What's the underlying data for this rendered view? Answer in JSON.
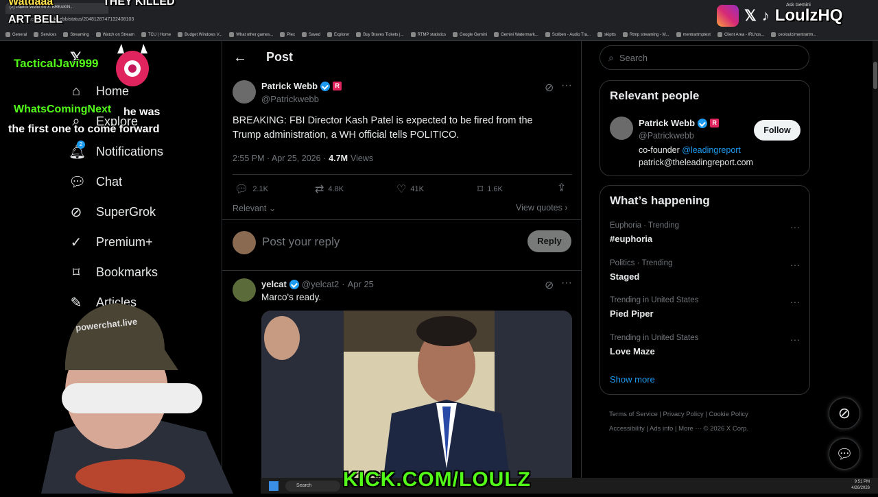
{
  "browser": {
    "tab_title": "(2) Patrick Webb on X: BREAKIN...",
    "url": "x.com/Patrickwebb/status/2048128747132408103",
    "bookmarks": [
      "General",
      "Services",
      "Streaming",
      "Watch on Stream",
      "TCU | Home",
      "Budget Windows V...",
      "What other games...",
      "Plex",
      "Saved",
      "Explorer",
      "Buy Braves Tickets |...",
      "RTMP statistics",
      "Google Gemini",
      "Gemini Watermark...",
      "Scriben - Audio Tra...",
      "skiptts",
      "Rtmp streaming - M...",
      "mentrartmptest",
      "Client Area - lRLhos...",
      "ceoloulz/mentrartm..."
    ],
    "ask_gemini": "Ask Gemini"
  },
  "nav": {
    "items": [
      {
        "label": "Home"
      },
      {
        "label": "Explore"
      },
      {
        "label": "Notifications",
        "badge": "2"
      },
      {
        "label": "Chat"
      },
      {
        "label": "SuperGrok"
      },
      {
        "label": "Premium+"
      },
      {
        "label": "Bookmarks"
      },
      {
        "label": "Articles"
      }
    ]
  },
  "post_header": {
    "title": "Post"
  },
  "post": {
    "author_name": "Patrick Webb",
    "author_handle": "@Patrickwebb",
    "text": "BREAKING: FBI Director Kash Patel is expected to be fired from the Trump administration, a WH official tells POLITICO.",
    "time": "2:55 PM · Apr 25, 2026 ·",
    "views_count": "4.7M",
    "views_label": "Views",
    "replies": "2.1K",
    "reposts": "4.8K",
    "likes": "41K",
    "bookmarks": "1.6K",
    "relevant_label": "Relevant",
    "view_quotes": "View quotes"
  },
  "reply_box": {
    "placeholder": "Post your reply",
    "button": "Reply"
  },
  "reply": {
    "author_name": "yelcat",
    "author_handle": "@yelcat2",
    "date": "Apr 25",
    "text": "Marco's ready."
  },
  "search": {
    "placeholder": "Search"
  },
  "relevant_people": {
    "title": "Relevant people",
    "name": "Patrick Webb",
    "handle": "@Patrickwebb",
    "follow": "Follow",
    "bio_prefix": "co-founder",
    "bio_link": "@leadingreport",
    "bio_email": "patrick@theleadingreport.com"
  },
  "whats_happening": {
    "title": "What’s happening",
    "trends": [
      {
        "context": "Euphoria · Trending",
        "name": "#euphoria"
      },
      {
        "context": "Politics · Trending",
        "name": "Staged"
      },
      {
        "context": "Trending in United States",
        "name": "Pied Piper"
      },
      {
        "context": "Trending in United States",
        "name": "Love Maze"
      }
    ],
    "show_more": "Show more"
  },
  "footer": {
    "links": [
      "Terms of Service",
      "Privacy Policy",
      "Cookie Policy",
      "Accessibility",
      "Ads info",
      "More ···"
    ],
    "copyright": "© 2026 X Corp."
  },
  "overlay": {
    "brand": "LoulzHQ",
    "top_left_1": "Watdaaa",
    "top_left_2": "THEY KILLED",
    "top_left_3": "ART BELL",
    "chat_user_1": "TacticalJavi999",
    "chat_user_2": "WhatsComingNext",
    "chat_msg_2": "he was the first one to come forward",
    "kick": "KICK.COM/LOULZ",
    "cap_text": "powerchat.live"
  },
  "taskbar": {
    "search": "Search",
    "time": "9:51 PM",
    "date": "4/26/2026"
  }
}
